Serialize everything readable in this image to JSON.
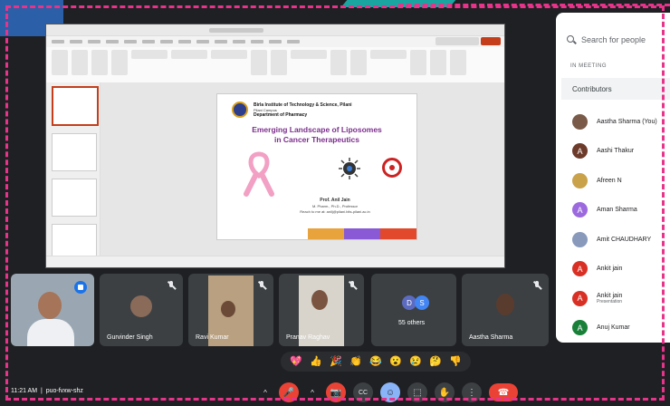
{
  "colors": {
    "accent_pink": "#e8338a",
    "meet_bg": "#1f2023",
    "tile_bg": "#3c4043",
    "end_call": "#ea4335",
    "ppt_accent": "#c43e1c"
  },
  "slide": {
    "institute": "Birla Institute of Technology & Science, Pilani",
    "campus": "Pilani Campus",
    "department": "Department of Pharmacy",
    "title_line1": "Emerging Landscape of Liposomes",
    "title_line2": "in Cancer Therapeutics",
    "presenter": "Prof. Anil Jain",
    "qualifications": "M. Pharm., Ph.D., Professor",
    "contact": "Reach to me at: anilj@pilani.bits-pilani.ac.in"
  },
  "people_panel": {
    "search_placeholder": "Search for people",
    "in_meeting_label": "IN MEETING",
    "contributors_label": "Contributors",
    "participants": [
      {
        "name": "Aastha Sharma (You)",
        "initial": "",
        "color": "#7a5a48",
        "sub": ""
      },
      {
        "name": "Aashi Thakur",
        "initial": "A",
        "color": "#6d3b2a",
        "sub": ""
      },
      {
        "name": "Afreen N",
        "initial": "",
        "color": "#c9a24a",
        "sub": ""
      },
      {
        "name": "Aman Sharma",
        "initial": "A",
        "color": "#9c6ade",
        "sub": ""
      },
      {
        "name": "Amit CHAUDHARY",
        "initial": "",
        "color": "#8899bb",
        "sub": ""
      },
      {
        "name": "Ankit jain",
        "initial": "A",
        "color": "#d93025",
        "sub": ""
      },
      {
        "name": "Ankit jain",
        "initial": "A",
        "color": "#d93025",
        "sub": "Presentation"
      },
      {
        "name": "Anuj Kumar",
        "initial": "A",
        "color": "#188038",
        "sub": ""
      }
    ]
  },
  "tiles": [
    {
      "name": ""
    },
    {
      "name": "Gurvinder Singh"
    },
    {
      "name": "Ravi Kumar"
    },
    {
      "name": "Pranav Raghav"
    },
    {
      "name": "55 others",
      "avatars": [
        "D",
        "S"
      ]
    },
    {
      "name": "Aastha Sharma"
    }
  ],
  "reactions": [
    "💖",
    "👍",
    "🎉",
    "👏",
    "😂",
    "😮",
    "😢",
    "🤔",
    "👎"
  ],
  "meeting": {
    "time": "11:21 AM",
    "code": "puo-fvxw-shz"
  },
  "controls": {
    "chevron": "^",
    "mic": "🎤",
    "camera": "📷",
    "captions": "CC",
    "emoji": "☺",
    "present": "⬚",
    "hand": "✋",
    "more": "⋮",
    "end": "☎"
  }
}
